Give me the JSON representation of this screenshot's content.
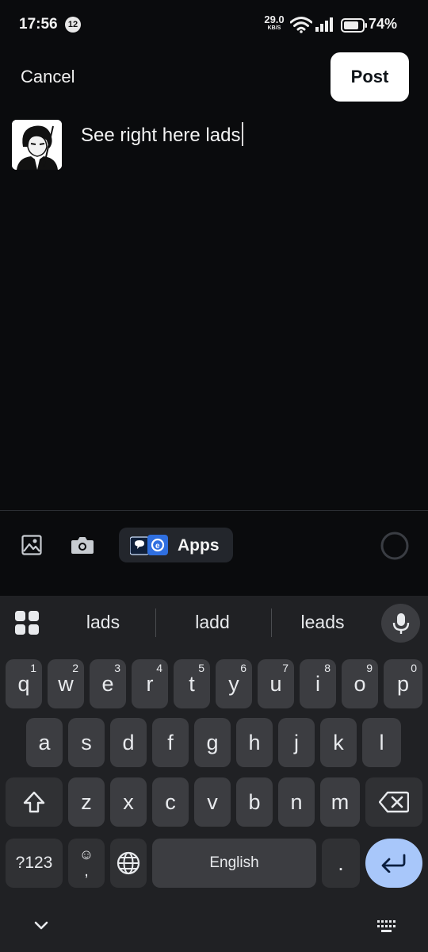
{
  "status_bar": {
    "time": "17:56",
    "notification_count": "12",
    "net_speed_value": "29.0",
    "net_speed_unit": "KB/S",
    "battery_percent": "74%"
  },
  "header": {
    "cancel_label": "Cancel",
    "post_label": "Post"
  },
  "compose": {
    "text": "See right here lads"
  },
  "toolbar": {
    "apps_label": "Apps"
  },
  "keyboard": {
    "suggestions": [
      "lads",
      "ladd",
      "leads"
    ],
    "row1": [
      {
        "label": "q",
        "hint": "1"
      },
      {
        "label": "w",
        "hint": "2"
      },
      {
        "label": "e",
        "hint": "3"
      },
      {
        "label": "r",
        "hint": "4"
      },
      {
        "label": "t",
        "hint": "5"
      },
      {
        "label": "y",
        "hint": "6"
      },
      {
        "label": "u",
        "hint": "7"
      },
      {
        "label": "i",
        "hint": "8"
      },
      {
        "label": "o",
        "hint": "9"
      },
      {
        "label": "p",
        "hint": "0"
      }
    ],
    "row2": [
      "a",
      "s",
      "d",
      "f",
      "g",
      "h",
      "j",
      "k",
      "l"
    ],
    "row3": [
      "z",
      "x",
      "c",
      "v",
      "b",
      "n",
      "m"
    ],
    "symbols_label": "?123",
    "emoji_key_top": "☺",
    "emoji_key_bottom": ",",
    "space_label": "English",
    "period_label": "."
  },
  "colors": {
    "background": "#0a0b0d",
    "post_button": "#ffffff",
    "keyboard_bg": "#202124",
    "key_bg": "#3c3d41",
    "enter_key": "#a8c7fa"
  }
}
